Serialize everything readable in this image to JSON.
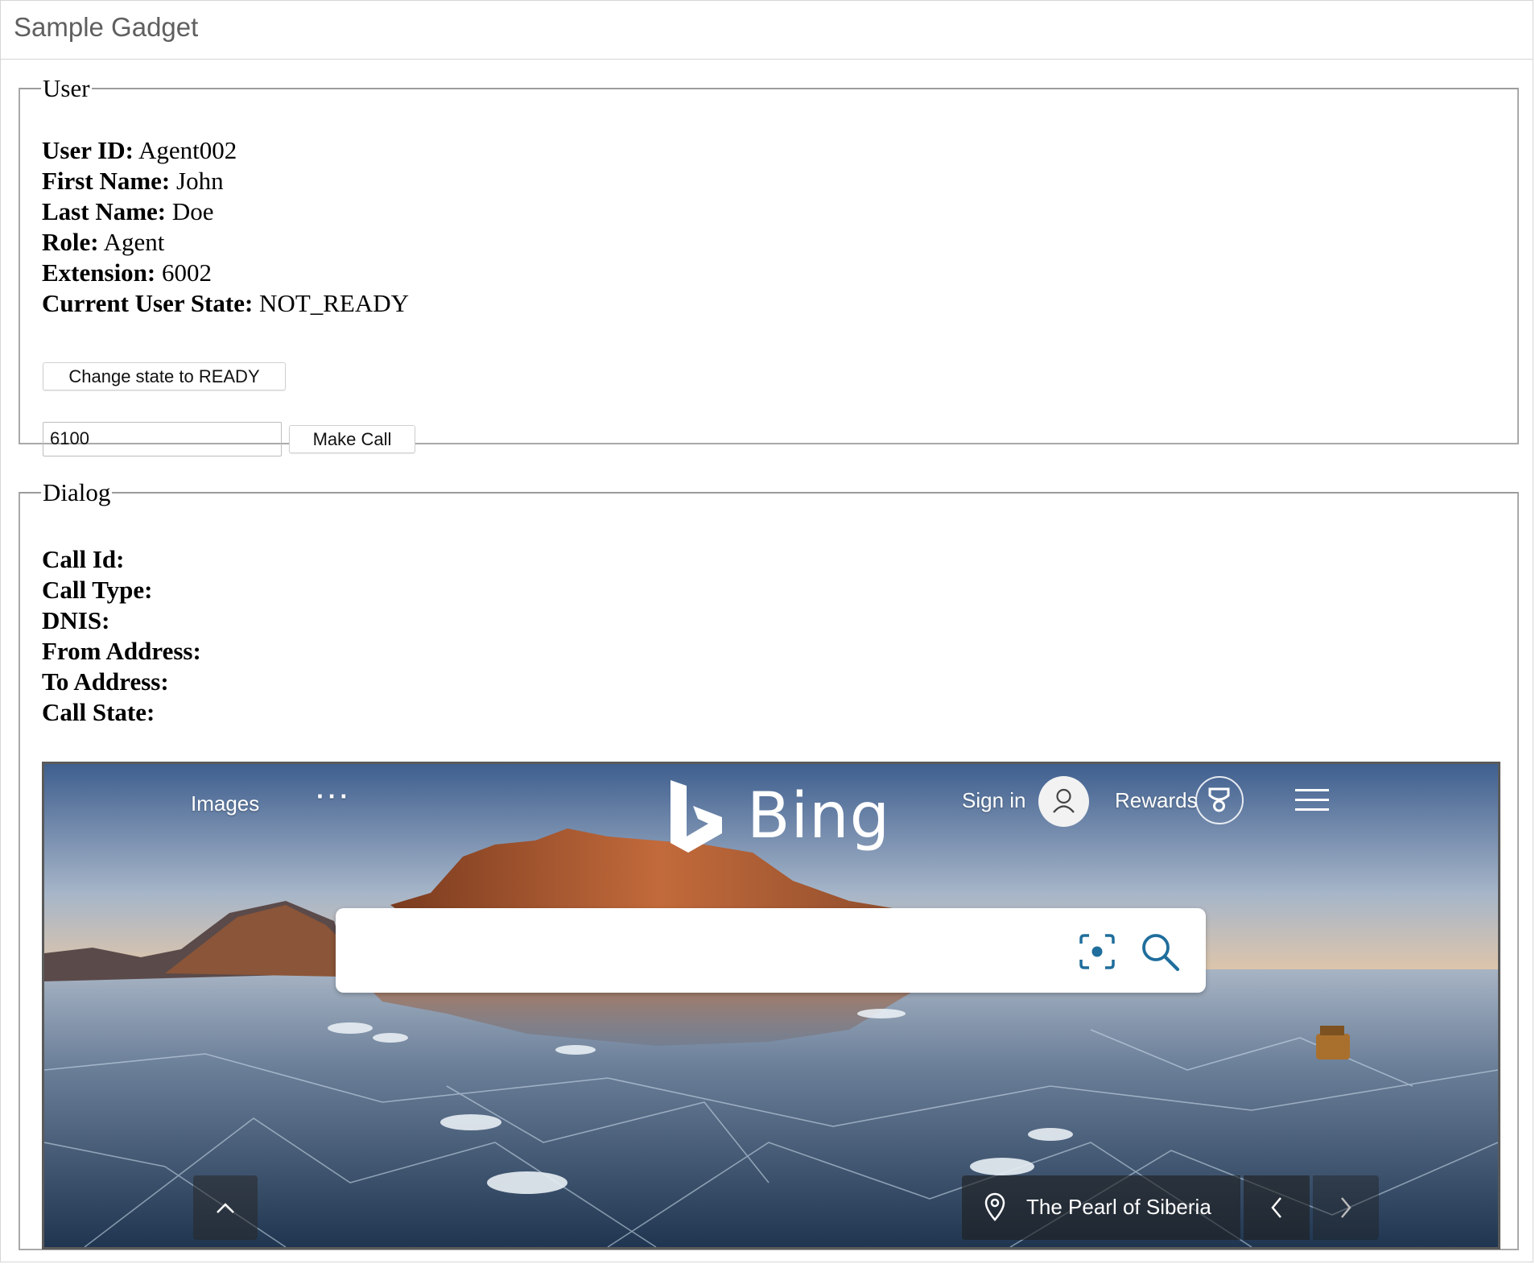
{
  "gadget": {
    "title": "Sample Gadget"
  },
  "user": {
    "legend": "User",
    "fields": [
      {
        "label": "User ID:",
        "value": "Agent002"
      },
      {
        "label": "First Name:",
        "value": "John"
      },
      {
        "label": "Last Name:",
        "value": "Doe"
      },
      {
        "label": "Role:",
        "value": "Agent"
      },
      {
        "label": "Extension:",
        "value": "6002"
      },
      {
        "label": "Current User State:",
        "value": "NOT_READY"
      }
    ],
    "change_state_label": "Change state to READY",
    "dial_value": "6100",
    "make_call_label": "Make Call"
  },
  "dialog": {
    "legend": "Dialog",
    "fields": [
      {
        "label": "Call Id:",
        "value": ""
      },
      {
        "label": "Call Type:",
        "value": ""
      },
      {
        "label": "DNIS:",
        "value": ""
      },
      {
        "label": "From Address:",
        "value": ""
      },
      {
        "label": "To Address:",
        "value": ""
      },
      {
        "label": "Call State:",
        "value": ""
      }
    ]
  },
  "bing": {
    "nav_images": "Images",
    "nav_more": "···",
    "logo_text": "Bing",
    "sign_in": "Sign in",
    "rewards": "Rewards",
    "search_value": "",
    "caption": "The Pearl of Siberia",
    "icons": {
      "avatar": "user-avatar-icon",
      "rewards": "trophy-icon",
      "menu": "hamburger-menu-icon",
      "visual_search": "visual-search-icon",
      "search": "search-icon",
      "scroll_up": "chevron-up-icon",
      "location": "location-pin-icon",
      "prev": "chevron-left-icon",
      "next": "chevron-right-icon"
    }
  }
}
